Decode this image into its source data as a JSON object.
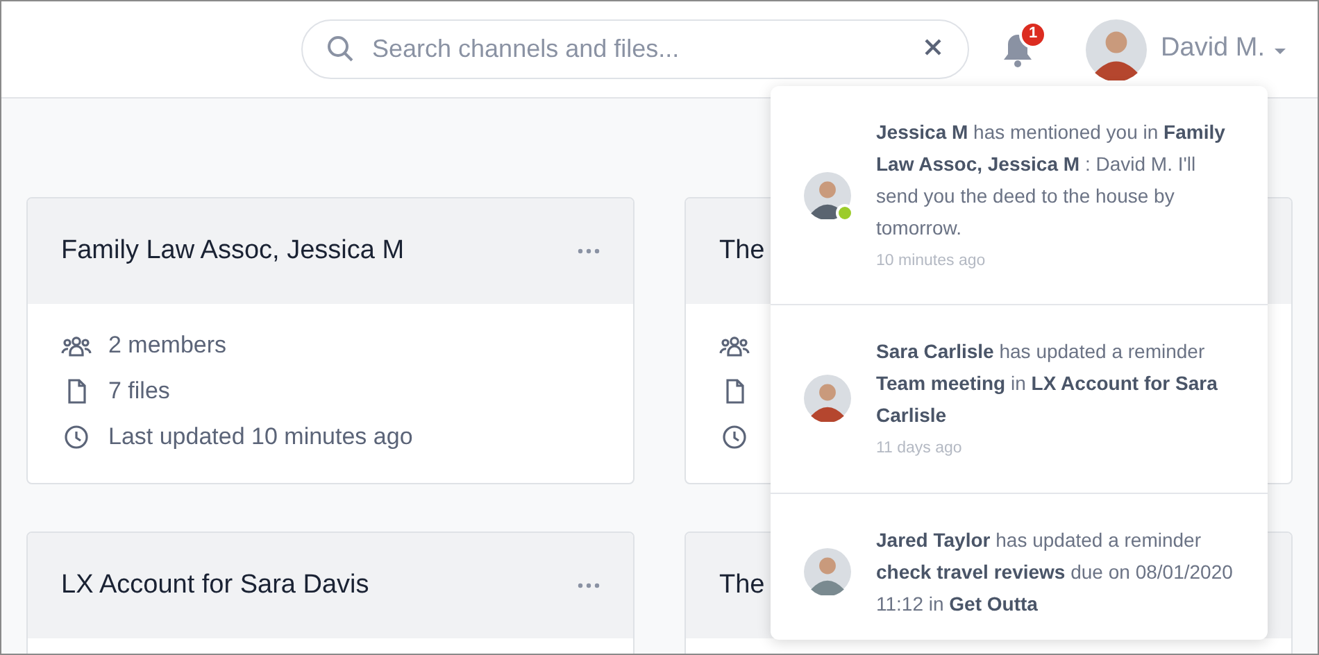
{
  "header": {
    "search": {
      "placeholder": "Search channels and files..."
    },
    "notifications_badge": "1",
    "user": {
      "name": "David M."
    }
  },
  "cards": [
    {
      "title": "Family Law Assoc, Jessica M",
      "menu": true,
      "rows": [
        {
          "kind": "members",
          "text": "2 members"
        },
        {
          "kind": "files",
          "text": "7 files"
        },
        {
          "kind": "updated",
          "text": "Last updated 10 minutes ago"
        }
      ]
    },
    {
      "title": "The",
      "rows": [
        {
          "kind": "members"
        },
        {
          "kind": "files"
        },
        {
          "kind": "updated"
        }
      ]
    },
    {
      "title": "LX Account for Sara Davis",
      "menu": true
    },
    {
      "title": "The"
    }
  ],
  "notifications": [
    {
      "online": true,
      "text": "**Jessica M** has mentioned you in **Family Law Assoc, Jessica M** : David M. I'll send you the deed to the house by tomorrow.",
      "time": "10 minutes ago"
    },
    {
      "online": false,
      "text": "**Sara Carlisle** has updated a reminder **Team meeting** in **LX Account for Sara Carlisle**",
      "time": "11 days ago"
    },
    {
      "online": false,
      "text": "**Jared Taylor** has updated a reminder **check travel reviews** due on 08/01/2020 11:12 in **Get Outta**"
    }
  ]
}
